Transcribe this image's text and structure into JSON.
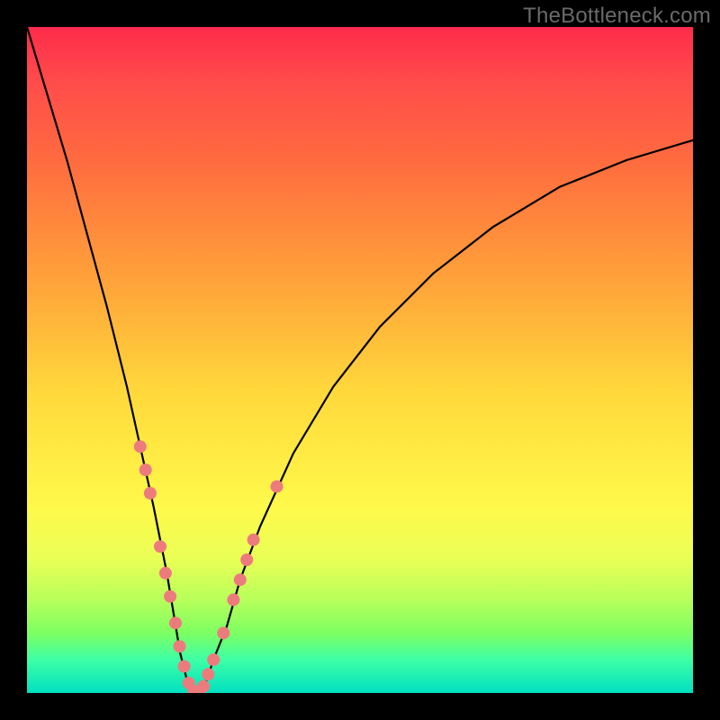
{
  "watermark": "TheBottleneck.com",
  "colors": {
    "frame": "#000000",
    "curve": "#000000",
    "marker": "#ed7b7d",
    "gradient_top": "#ff2b4b",
    "gradient_bottom": "#00e0c0"
  },
  "chart_data": {
    "type": "line",
    "title": "",
    "xlabel": "",
    "ylabel": "",
    "xlim": [
      0,
      100
    ],
    "ylim": [
      0,
      100
    ],
    "note": "Axes are unlabeled; values are estimated from pixel positions on a 0–100 normalized grid (origin bottom-left). Curve shows bottleneck-percentage vs component-balance; lower y = better (green).",
    "series": [
      {
        "name": "bottleneck-curve",
        "x": [
          0,
          3,
          6,
          9,
          12,
          15,
          17,
          19,
          21,
          22,
          23,
          24,
          25,
          26,
          27,
          28,
          30,
          32,
          35,
          40,
          46,
          53,
          61,
          70,
          80,
          90,
          100
        ],
        "y": [
          100,
          90,
          80,
          69,
          58,
          46,
          37,
          28,
          18,
          12,
          6,
          2,
          0,
          0,
          2,
          5,
          10,
          17,
          25,
          36,
          46,
          55,
          63,
          70,
          76,
          80,
          83
        ]
      }
    ],
    "markers": {
      "name": "highlighted-points",
      "comment": "Pink dot/segment markers clustered near the V bottom and lower slopes.",
      "points": [
        {
          "x": 17.0,
          "y": 37.0
        },
        {
          "x": 17.8,
          "y": 33.5
        },
        {
          "x": 18.5,
          "y": 30.0
        },
        {
          "x": 20.0,
          "y": 22.0
        },
        {
          "x": 20.8,
          "y": 18.0
        },
        {
          "x": 21.5,
          "y": 14.5
        },
        {
          "x": 22.3,
          "y": 10.5
        },
        {
          "x": 22.9,
          "y": 7.0
        },
        {
          "x": 23.6,
          "y": 4.0
        },
        {
          "x": 24.3,
          "y": 1.5
        },
        {
          "x": 25.0,
          "y": 0.3
        },
        {
          "x": 25.8,
          "y": 0.2
        },
        {
          "x": 26.5,
          "y": 1.0
        },
        {
          "x": 27.2,
          "y": 2.8
        },
        {
          "x": 28.0,
          "y": 5.0
        },
        {
          "x": 29.5,
          "y": 9.0
        },
        {
          "x": 31.0,
          "y": 14.0
        },
        {
          "x": 32.0,
          "y": 17.0
        },
        {
          "x": 33.0,
          "y": 20.0
        },
        {
          "x": 34.0,
          "y": 23.0
        },
        {
          "x": 37.5,
          "y": 31.0
        }
      ]
    }
  }
}
